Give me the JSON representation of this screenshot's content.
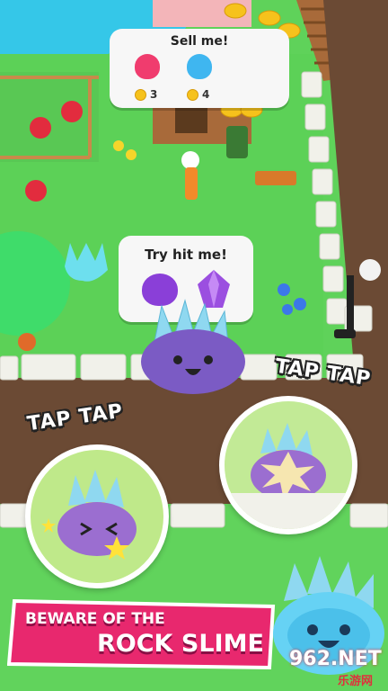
{
  "bubbles": {
    "sell": {
      "title": "Sell me!",
      "items": [
        {
          "name": "red-slime",
          "color": "#f03c6e",
          "price": "3"
        },
        {
          "name": "blue-slime",
          "color": "#3fb6f0",
          "price": "4"
        }
      ]
    },
    "hit": {
      "title": "Try hit me!",
      "items": [
        {
          "name": "purple-slime",
          "color": "#8a3fd8"
        },
        {
          "name": "purple-crystal",
          "color": "#9b4fe0"
        }
      ]
    }
  },
  "tap_left": "TAP TAP",
  "tap_right": "TAP TAP",
  "banner": {
    "line1": "BEWARE OF THE",
    "line2": "ROCK SLIME",
    "color": "#e8286e"
  },
  "watermark": {
    "brand": "962.NET",
    "sub": "乐游网"
  },
  "colors": {
    "grass": "#5fd25a",
    "path": "#6b4a34",
    "stone": "#f1f1ea",
    "rock_slime": "#7b5bc4",
    "crystal": "#8fd8f0"
  }
}
